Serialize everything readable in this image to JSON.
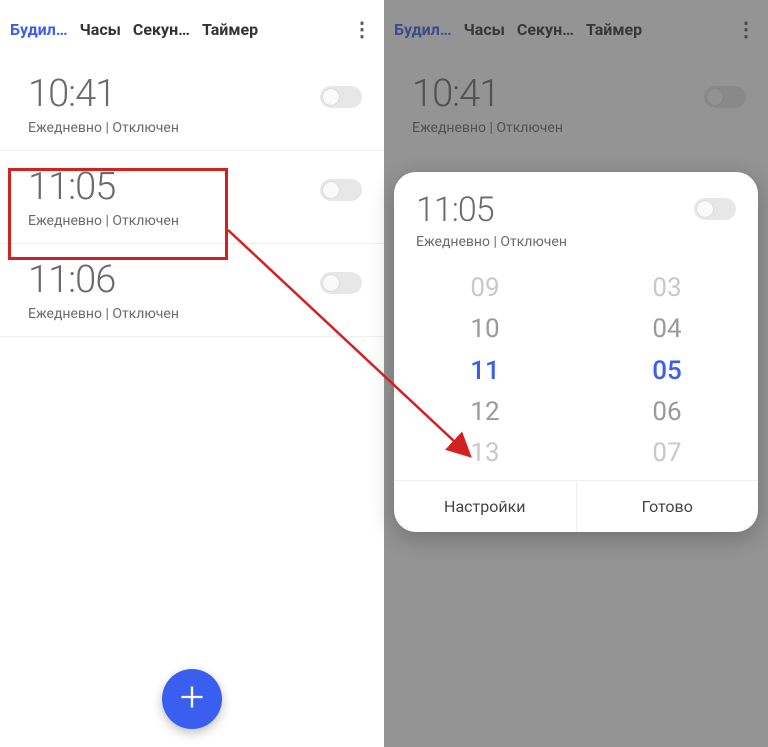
{
  "tabs": {
    "alarm": "Будил…",
    "clock": "Часы",
    "stopwatch": "Секун…",
    "timer": "Таймер"
  },
  "alarms": [
    {
      "time": "10:41",
      "sub": "Ежедневно | Отключен"
    },
    {
      "time": "11:05",
      "sub": "Ежедневно | Отключен"
    },
    {
      "time": "11:06",
      "sub": "Ежедневно | Отключен"
    }
  ],
  "sheet": {
    "time": "11:05",
    "sub": "Ежедневно | Отключен",
    "hours": [
      "09",
      "10",
      "11",
      "12",
      "13"
    ],
    "minutes": [
      "03",
      "04",
      "05",
      "06",
      "07"
    ],
    "settings_label": "Настройки",
    "done_label": "Готово"
  }
}
